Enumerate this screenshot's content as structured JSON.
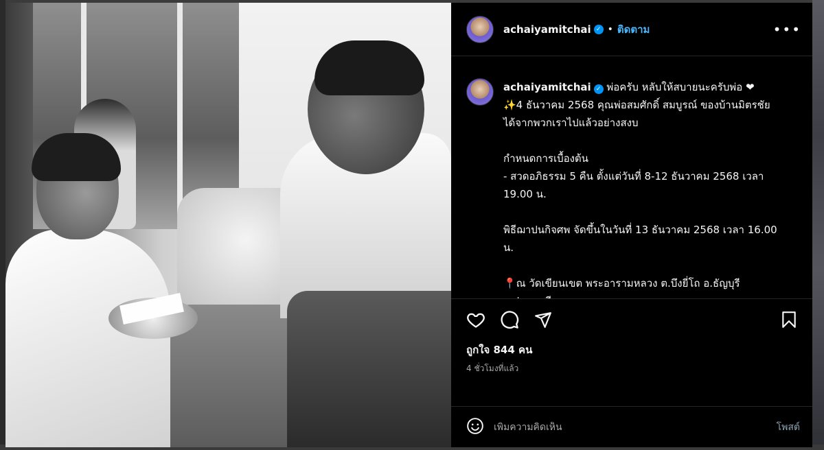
{
  "post": {
    "username": "achaiyamitchai",
    "follow_label": "ติดตาม",
    "dot": "•",
    "more": "•••",
    "caption": {
      "username": "achaiyamitchai",
      "line1": " พ่อครับ หลับให้สบายนะครับพ่อ ❤",
      "line2": "✨4 ธันวาคม 2568 คุณพ่อสมศักดิ์ สมบูรณ์ ของบ้านมิตรชัย ได้จากพวกเราไปแล้วอย่างสงบ",
      "para2": "กำหนดการเบื้องต้น\n- สวดอภิธรรม 5 คืน ตั้งแต่วันที่ 8-12 ธันวาคม 2568 เวลา 19.00 น.",
      "para3": "พิธีฌาปนกิจศพ จัดขึ้นในวันที่ 13 ธันวาคม 2568 เวลา 16.00 น.",
      "para4": "📍ณ วัดเขียนเขต พระอารามหลวง ต.บึงยี่โถ อ.ธัญบุรี จ.ปทุมธานี"
    },
    "likes": "ถูกใจ 844 คน",
    "time_ago": "4 ชั่วโมงที่แล้ว",
    "comment_placeholder": "เพิ่มความคิดเห็น",
    "post_button": "โพสต์"
  },
  "icons": {
    "verified": "verified-badge-icon",
    "like": "heart-icon",
    "comment": "comment-bubble-icon",
    "share": "paper-plane-icon",
    "save": "bookmark-icon",
    "emoji": "smiley-icon"
  },
  "colors": {
    "background": "#000000",
    "follow": "#4cb5f9",
    "verified": "#0095f6",
    "secondary_text": "#a8a8a8"
  }
}
